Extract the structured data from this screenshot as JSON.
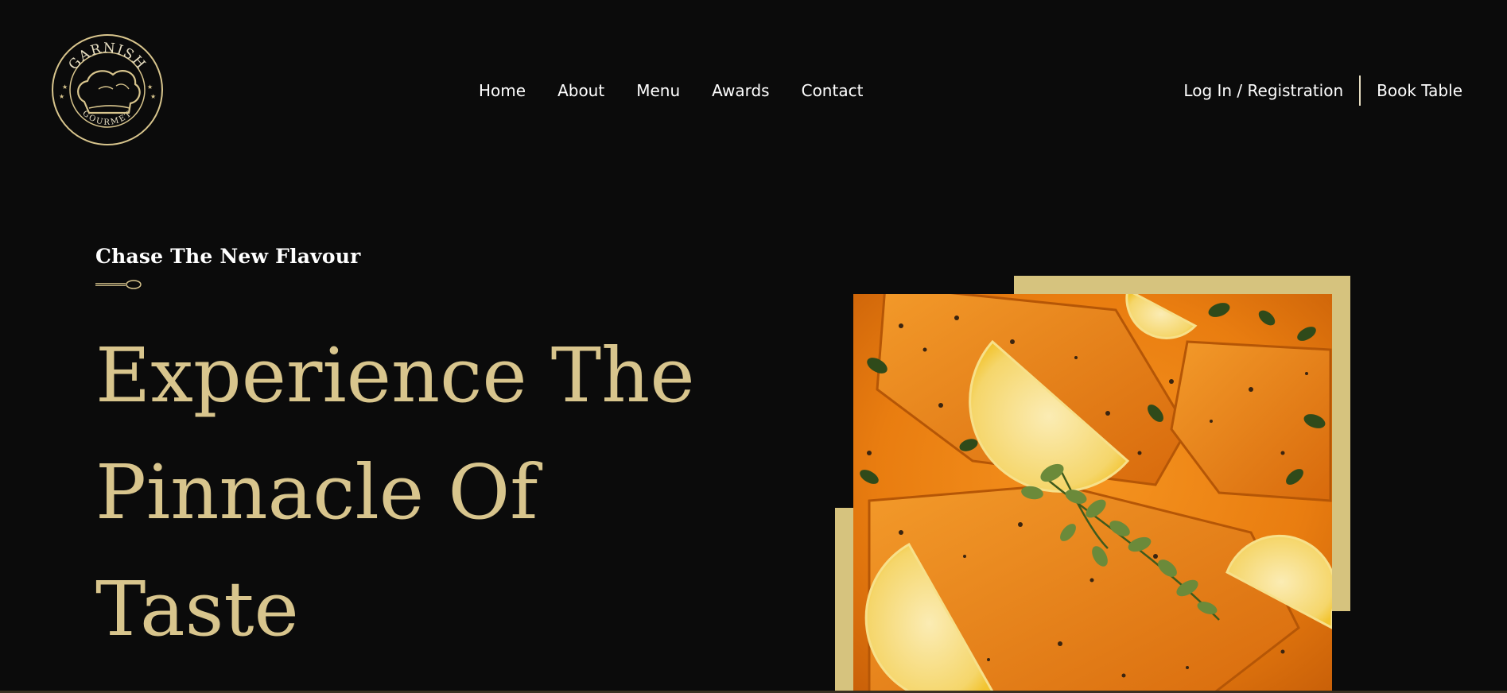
{
  "brand": {
    "logo_top_text": "GARNISH",
    "logo_bottom_text": "GOURMET",
    "gold": "#d8c58d"
  },
  "nav": {
    "items": [
      {
        "label": "Home"
      },
      {
        "label": "About"
      },
      {
        "label": "Menu"
      },
      {
        "label": "Awards"
      },
      {
        "label": "Contact"
      }
    ]
  },
  "header_actions": {
    "login_label": "Log In / Registration",
    "book_label": "Book Table"
  },
  "hero": {
    "tagline": "Chase The New Flavour",
    "title_lines": [
      "Experience The",
      "Pinnacle Of",
      "Taste"
    ],
    "image_icon": "salmon-dish-image"
  },
  "colors": {
    "background": "#0b0b0b",
    "accent_gold": "#d6c37e",
    "text": "#ffffff"
  }
}
